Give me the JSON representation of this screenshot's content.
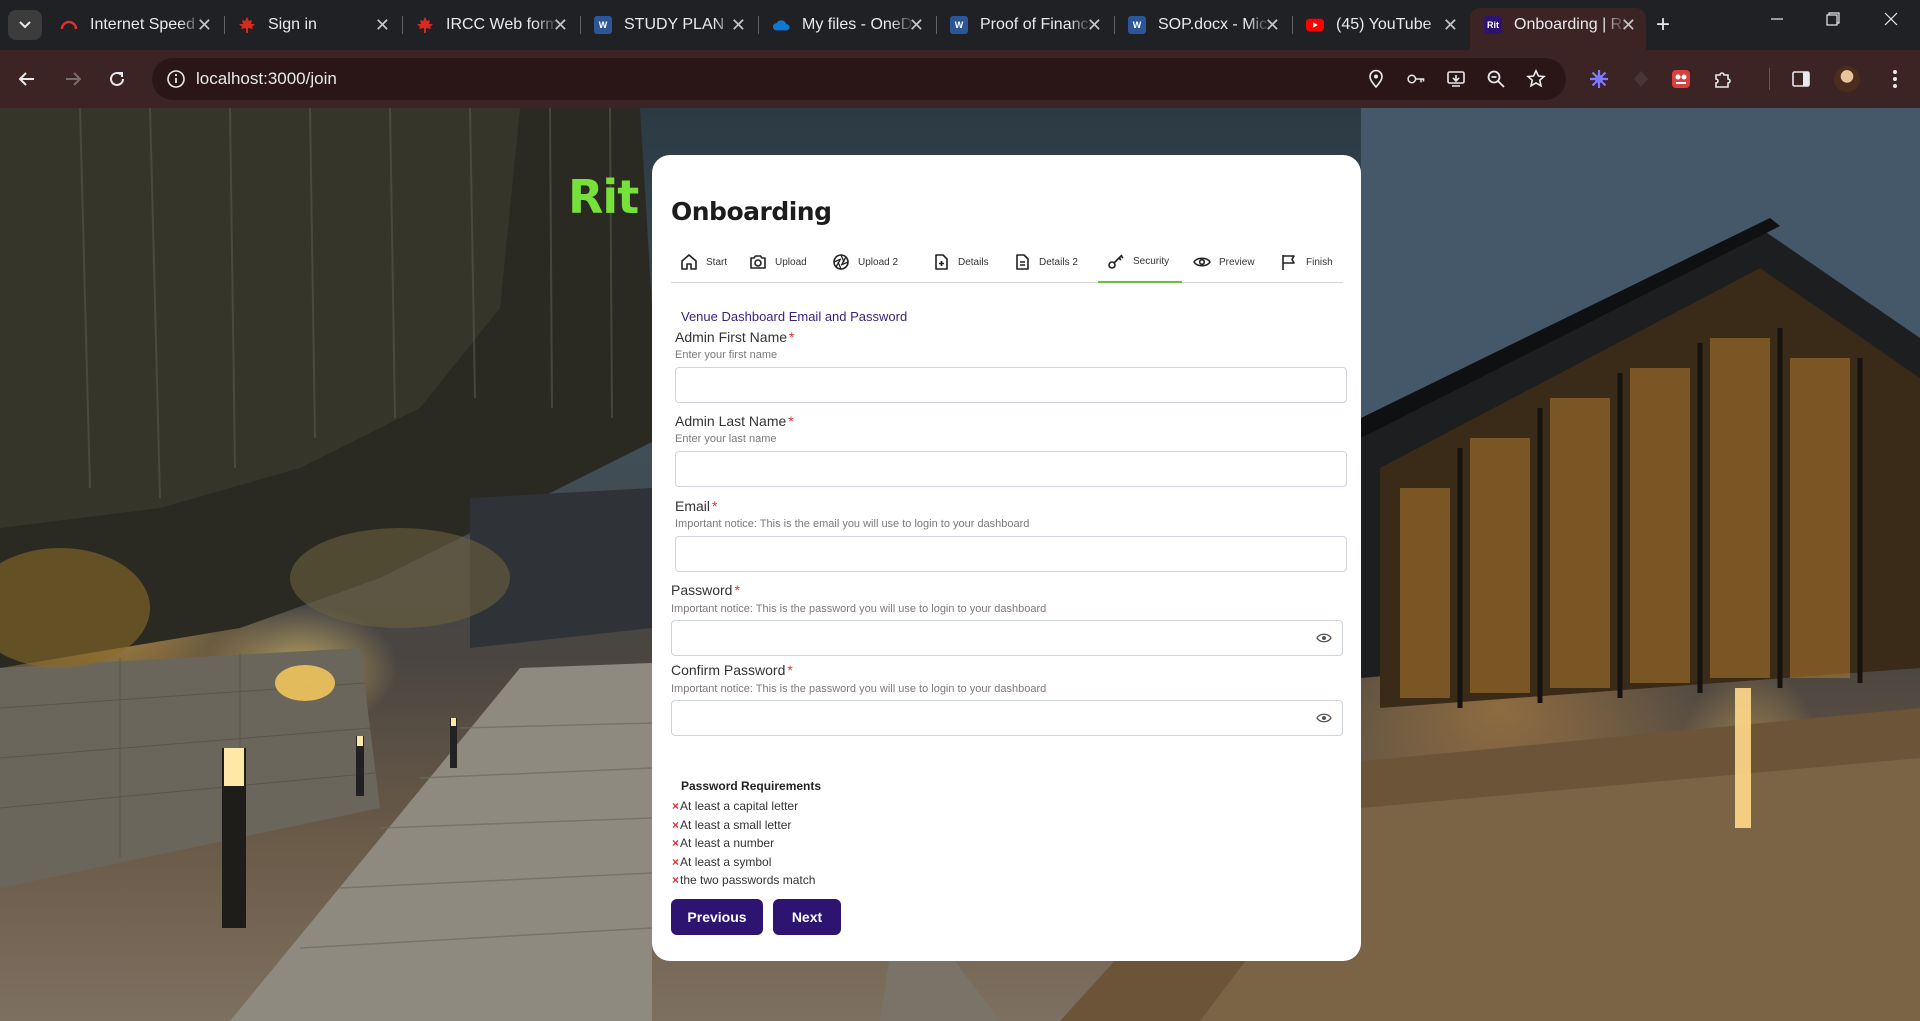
{
  "browser": {
    "tabs": [
      {
        "title": "Internet Speed Test",
        "favicon": "speedtest-icon",
        "color": "#e02d2d"
      },
      {
        "title": "Sign in",
        "favicon": "maple-leaf-icon",
        "color": "#d52b1e"
      },
      {
        "title": "IRCC Web form",
        "favicon": "maple-leaf-icon",
        "color": "#d52b1e"
      },
      {
        "title": "STUDY PLAN",
        "favicon": "word-icon",
        "color": "#2b579a"
      },
      {
        "title": "My files - OneDrive",
        "favicon": "onedrive-icon",
        "color": "#0f78d4"
      },
      {
        "title": "Proof of Finance",
        "favicon": "word-icon",
        "color": "#2b579a"
      },
      {
        "title": "SOP.docx - Microsoft Word",
        "favicon": "word-icon",
        "color": "#2b579a"
      },
      {
        "title": "(45) YouTube",
        "favicon": "youtube-icon",
        "color": "#ff0000"
      },
      {
        "title": "Onboarding | Rit",
        "favicon": "rit-icon",
        "color": "#2d1470",
        "active": true,
        "favicon_text": "Rit"
      }
    ],
    "url": "localhost:3000/join"
  },
  "app": {
    "logo": "Rit",
    "logo_color": "#78e03a",
    "page_title": "Onboarding",
    "steps": [
      {
        "label": "Start",
        "icon": "home-icon"
      },
      {
        "label": "Upload",
        "icon": "camera-icon"
      },
      {
        "label": "Upload 2",
        "icon": "aperture-icon"
      },
      {
        "label": "Details",
        "icon": "file-plus-icon"
      },
      {
        "label": "Details 2",
        "icon": "file-text-icon"
      },
      {
        "label": "Security",
        "icon": "key-icon",
        "active": true
      },
      {
        "label": "Preview",
        "icon": "eye-icon"
      },
      {
        "label": "Finish",
        "icon": "flag-icon"
      }
    ],
    "section_title": "Venue Dashboard Email and Password",
    "fields": {
      "first_name": {
        "label": "Admin First Name",
        "required": "*",
        "hint": "Enter your first name",
        "value": ""
      },
      "last_name": {
        "label": "Admin Last Name",
        "required": "*",
        "hint": "Enter your last name",
        "value": ""
      },
      "email": {
        "label": "Email",
        "required": "*",
        "hint": "Important notice: This is the email you will use to login to your dashboard",
        "value": ""
      },
      "password": {
        "label": "Password",
        "required": "*",
        "hint": "Important notice: This is the password you will use to login to your dashboard",
        "value": ""
      },
      "confirm_password": {
        "label": "Confirm Password",
        "required": "*",
        "hint": "Important notice: This is the password you will use to login to your dashboard",
        "value": ""
      }
    },
    "password_requirements": {
      "title": "Password Requirements",
      "mark": "×",
      "items": [
        "At least a capital letter",
        "At least a small letter",
        "At least a number",
        "At least a symbol",
        "the two passwords match"
      ]
    },
    "buttons": {
      "previous": "Previous",
      "next": "Next"
    },
    "colors": {
      "primary": "#2d1470",
      "accent_green": "#6bbf3a",
      "error": "#e03131",
      "section_title": "#3a1f7a"
    }
  }
}
